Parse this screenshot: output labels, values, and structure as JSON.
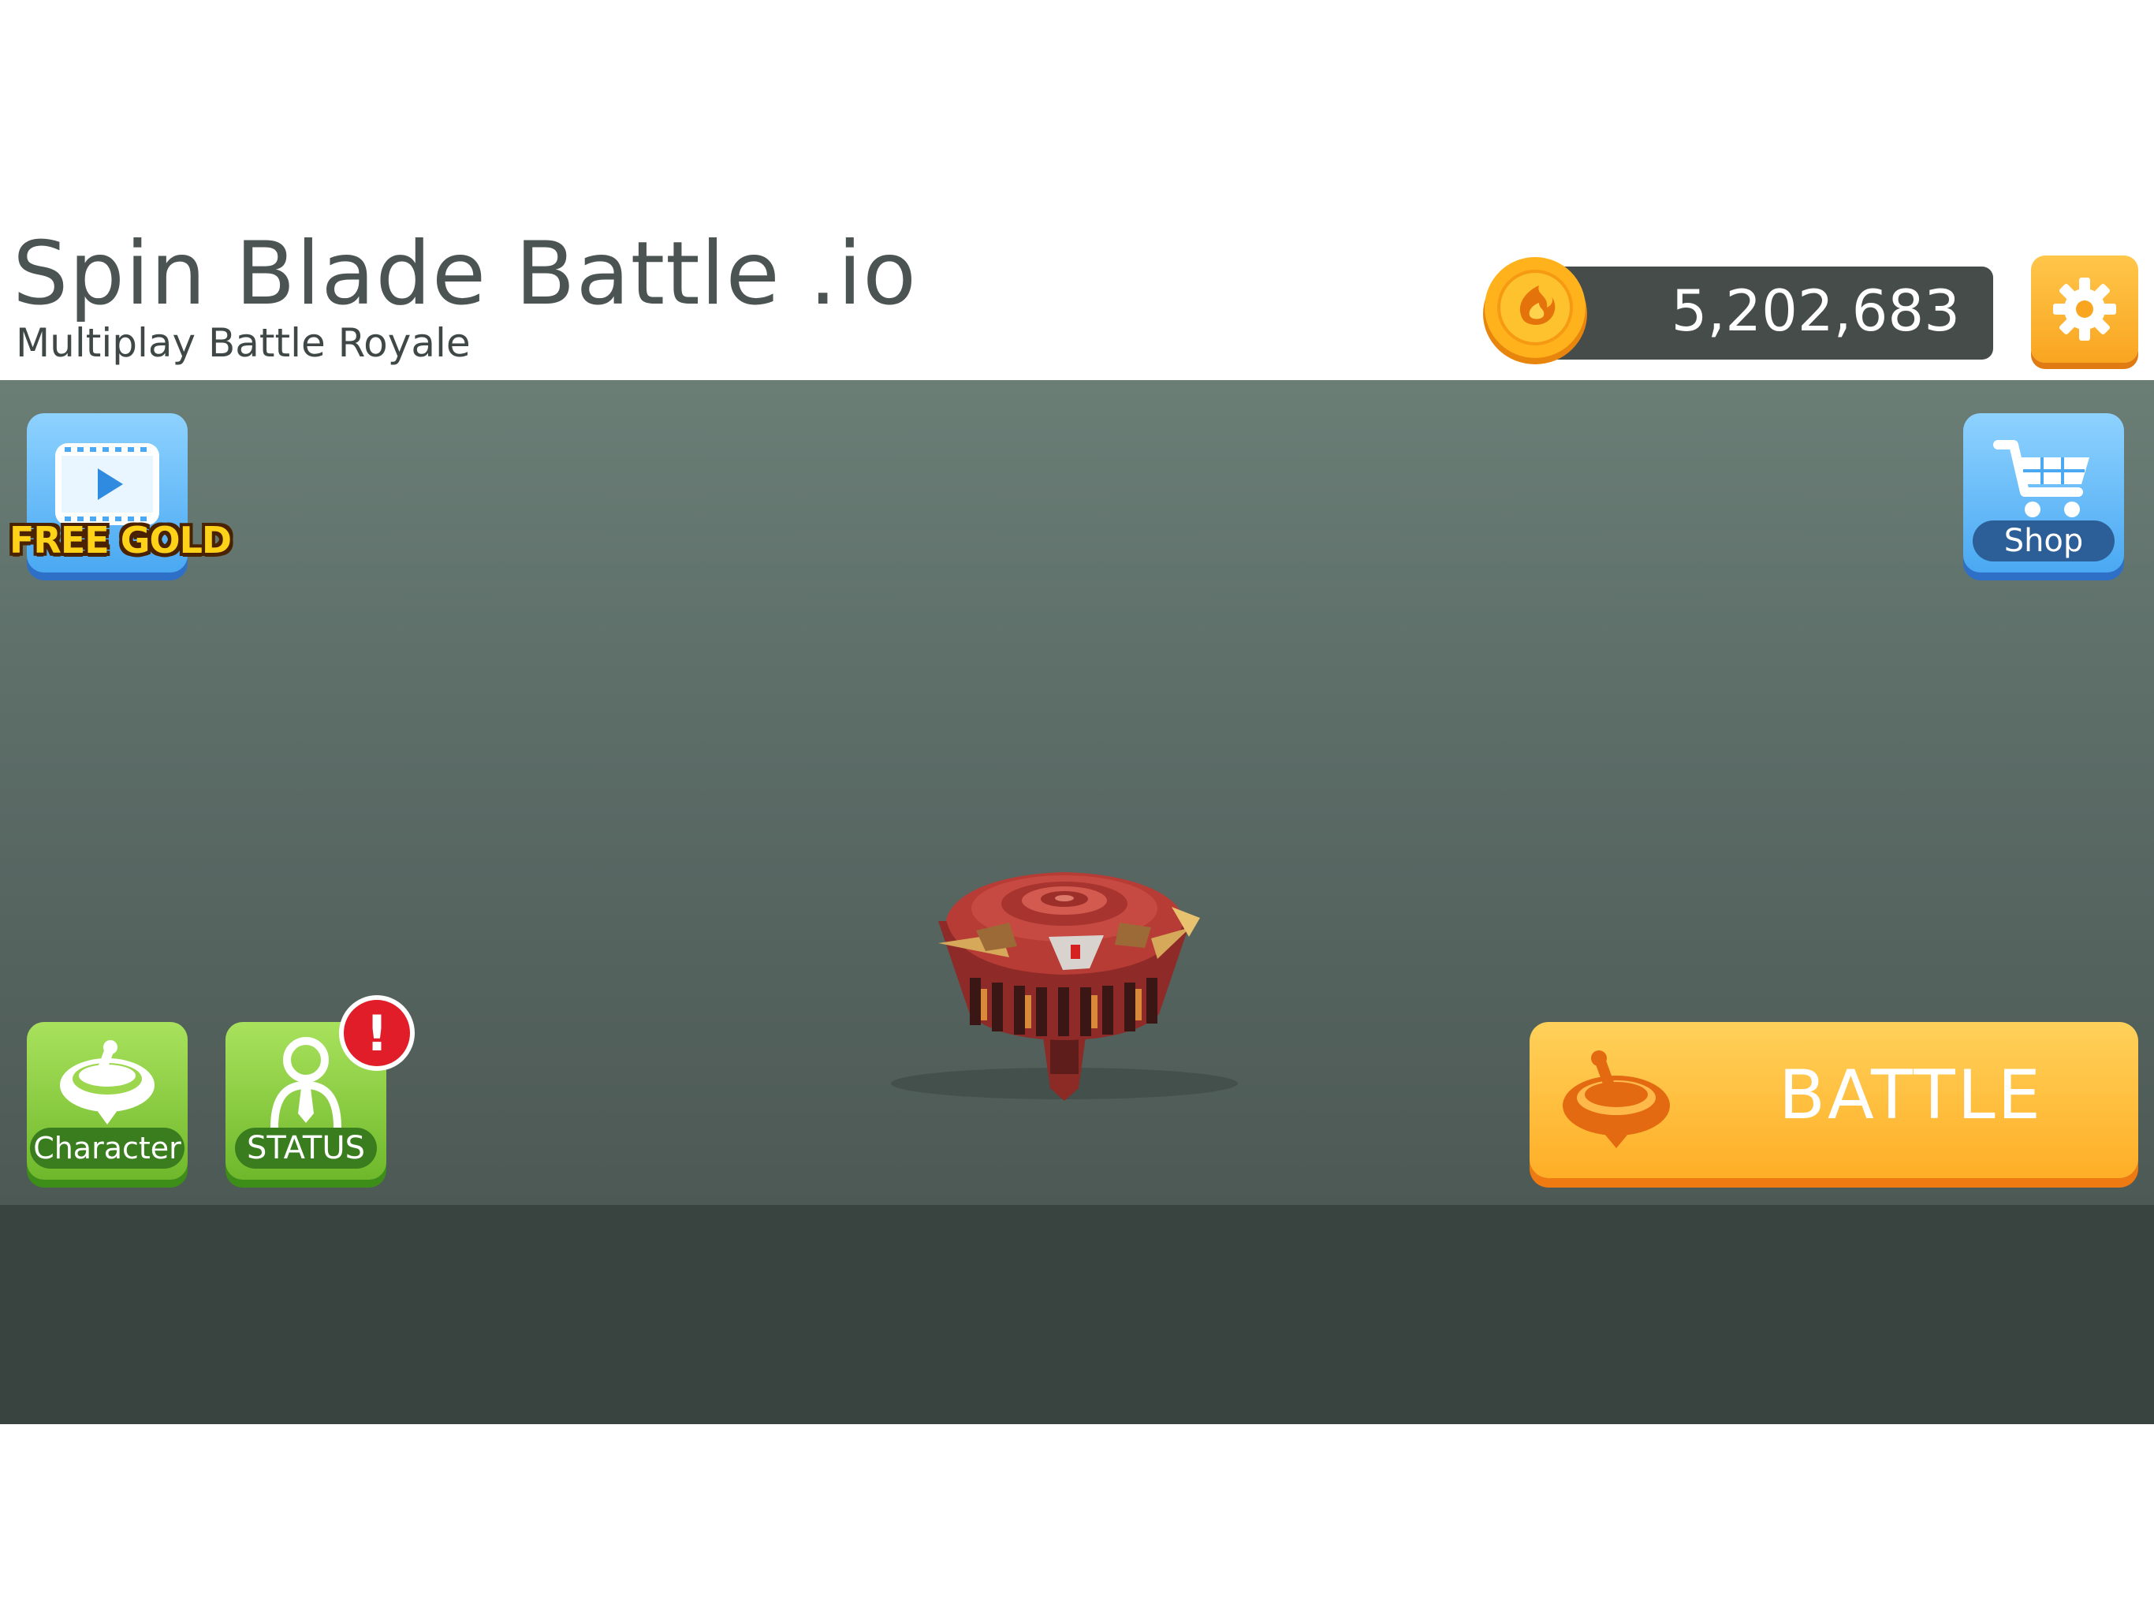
{
  "header": {
    "title": "Spin Blade Battle .io",
    "subtitle": "Multiplay Battle Royale"
  },
  "currency": {
    "gold_amount": "5,202,683",
    "icon": "gold-coin-icon",
    "color": "#f6a81a"
  },
  "buttons": {
    "free_gold_label": "FREE GOLD",
    "shop_label": "Shop",
    "character_label": "Character",
    "status_label": "STATUS",
    "status_alert": "!",
    "battle_label": "BATTLE",
    "settings_icon": "gear-icon"
  },
  "colors": {
    "accent_orange": "#ffb02e",
    "accent_blue": "#4aa9f2",
    "accent_green": "#7cc234",
    "alert_red": "#e01d28",
    "stage": "#5b6b66"
  }
}
